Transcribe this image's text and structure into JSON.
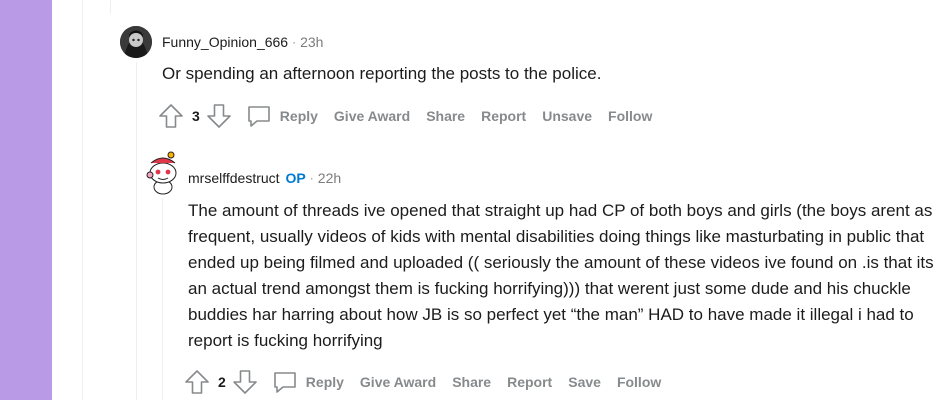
{
  "comments": [
    {
      "author": "Funny_Opinion_666",
      "is_op": false,
      "op_label": "",
      "time": "23h",
      "body": "Or spending an afternoon reporting the posts to the police.",
      "score": "3",
      "actions": {
        "reply": "Reply",
        "give_award": "Give Award",
        "share": "Share",
        "report": "Report",
        "save": "Unsave",
        "follow": "Follow"
      }
    },
    {
      "author": "mrselffdestruct",
      "is_op": true,
      "op_label": "OP",
      "time": "22h",
      "body": "The amount of threads ive opened that straight up had CP of both boys and girls (the boys arent as frequent, usually videos of kids with mental disabilities doing things like masturbating in public that ended up being filmed and uploaded (( seriously the amount of these videos ive found on .is that its an actual trend amongst them is fucking horrifying))) that werent just some dude and his chuckle buddies har harring about how JB is so perfect yet “the man” HAD to have made it illegal i had to report is fucking horrifying",
      "score": "2",
      "actions": {
        "reply": "Reply",
        "give_award": "Give Award",
        "share": "Share",
        "report": "Report",
        "save": "Save",
        "follow": "Follow"
      }
    }
  ],
  "meta_separator": "·",
  "icons": {
    "upvote": "upvote-arrow-icon",
    "downvote": "downvote-arrow-icon",
    "reply": "speech-bubble-icon"
  },
  "colors": {
    "sidebar": "#b99ae6",
    "op_badge": "#0079d3",
    "action_text": "#878a8c"
  }
}
